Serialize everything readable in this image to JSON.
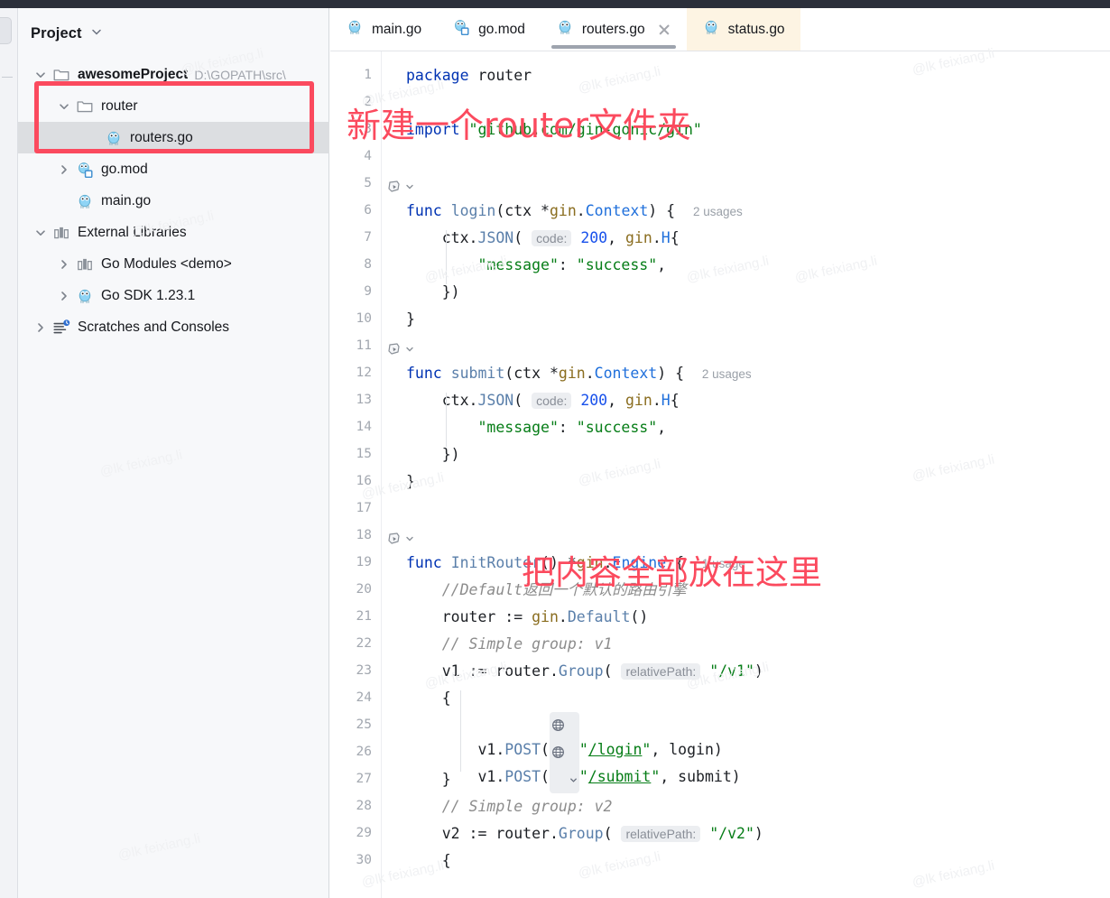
{
  "window": {
    "titlebar_color": "#2b2f3a"
  },
  "sidebar": {
    "title": "Project",
    "header_chevron_icon": "chevron-down-icon",
    "tree": [
      {
        "label": "awesomeProject",
        "sub": "D:\\GOPATH\\src\\",
        "icon": "folder-icon",
        "twisty": "chevron-down-icon",
        "depth": 0,
        "bold": true,
        "selected": false
      },
      {
        "label": "router",
        "sub": "",
        "icon": "folder-icon",
        "twisty": "chevron-down-icon",
        "depth": 1,
        "bold": false,
        "selected": false
      },
      {
        "label": "routers.go",
        "sub": "",
        "icon": "go-file-icon",
        "twisty": "",
        "depth": 2,
        "bold": false,
        "selected": true
      },
      {
        "label": "go.mod",
        "sub": "",
        "icon": "go-mod-icon",
        "twisty": "chevron-right-icon",
        "depth": 1,
        "bold": false,
        "selected": false
      },
      {
        "label": "main.go",
        "sub": "",
        "icon": "go-file-icon",
        "twisty": "",
        "depth": 1,
        "bold": false,
        "selected": false
      },
      {
        "label": "External Libraries",
        "sub": "",
        "icon": "library-icon",
        "twisty": "chevron-down-icon",
        "depth": 0,
        "bold": false,
        "selected": false
      },
      {
        "label": "Go Modules <demo>",
        "sub": "",
        "icon": "library-icon",
        "twisty": "chevron-right-icon",
        "depth": 1,
        "bold": false,
        "selected": false
      },
      {
        "label": "Go SDK 1.23.1",
        "sub": "",
        "icon": "go-file-icon",
        "twisty": "chevron-right-icon",
        "depth": 1,
        "bold": false,
        "selected": false
      },
      {
        "label": "Scratches and Consoles",
        "sub": "",
        "icon": "scratches-icon",
        "twisty": "chevron-right-icon",
        "depth": 0,
        "bold": false,
        "selected": false
      }
    ]
  },
  "tabs": [
    {
      "label": "main.go",
      "icon": "go-file-icon",
      "active": false,
      "cream": false,
      "closable": false
    },
    {
      "label": "go.mod",
      "icon": "go-mod-icon",
      "active": false,
      "cream": false,
      "closable": false
    },
    {
      "label": "routers.go",
      "icon": "go-file-icon",
      "active": true,
      "cream": false,
      "closable": true
    },
    {
      "label": "status.go",
      "icon": "go-file-icon",
      "active": false,
      "cream": true,
      "closable": false
    }
  ],
  "editor": {
    "first_line": 1,
    "last_line": 30,
    "lines": [
      {
        "n": 1,
        "text": "package router"
      },
      {
        "n": 2,
        "text": ""
      },
      {
        "n": 3,
        "text": "import \"github.com/gin-gonic/gin\""
      },
      {
        "n": 4,
        "text": ""
      },
      {
        "n": 5,
        "text": ""
      },
      {
        "n": 6,
        "text": "func login(ctx *gin.Context) {",
        "usages": "2 usages",
        "gutter": "run-gutter-icon"
      },
      {
        "n": 7,
        "text": "    ctx.JSON( code: 200, gin.H{"
      },
      {
        "n": 8,
        "text": "        \"message\": \"success\","
      },
      {
        "n": 9,
        "text": "    })"
      },
      {
        "n": 10,
        "text": "}"
      },
      {
        "n": 11,
        "text": ""
      },
      {
        "n": 12,
        "text": "func submit(ctx *gin.Context) {",
        "usages": "2 usages",
        "gutter": "run-gutter-icon"
      },
      {
        "n": 13,
        "text": "    ctx.JSON( code: 200, gin.H{"
      },
      {
        "n": 14,
        "text": "        \"message\": \"success\","
      },
      {
        "n": 15,
        "text": "    })"
      },
      {
        "n": 16,
        "text": "}"
      },
      {
        "n": 17,
        "text": ""
      },
      {
        "n": 18,
        "text": ""
      },
      {
        "n": 19,
        "text": "func InitRouter() *gin.Engine {",
        "usages": "1 usage",
        "gutter": "run-gutter-icon"
      },
      {
        "n": 20,
        "text": "    //Default返回一个默认的路由引擎"
      },
      {
        "n": 21,
        "text": "    router := gin.Default()"
      },
      {
        "n": 22,
        "text": "    // Simple group: v1"
      },
      {
        "n": 23,
        "text": "    v1 := router.Group( relativePath: \"/v1\")"
      },
      {
        "n": 24,
        "text": "    {"
      },
      {
        "n": 25,
        "text": "        v1.POST(\"/login\", login)"
      },
      {
        "n": 26,
        "text": "        v1.POST(\"/submit\", submit)"
      },
      {
        "n": 27,
        "text": "    }"
      },
      {
        "n": 28,
        "text": "    // Simple group: v2"
      },
      {
        "n": 29,
        "text": "    v2 := router.Group( relativePath: \"/v2\")"
      },
      {
        "n": 30,
        "text": "    {"
      }
    ],
    "param_hints": [
      "code:",
      "relativePath:"
    ],
    "usage_labels": [
      "2 usages",
      "2 usages",
      "1 usage"
    ],
    "gutter_icon": "run-gutter-icon",
    "url_icon": "globe-icon"
  },
  "annotations": [
    {
      "text": "新建一个router文件夹",
      "color": "#fb4a5e"
    },
    {
      "text": "把内容全部放在这里",
      "color": "#fb4a5e"
    }
  ],
  "highlight_box": {
    "color": "#fb4a5e"
  },
  "watermark": {
    "text": "@lk feixiang.li"
  },
  "colors": {
    "accent_red": "#fb4a5e",
    "keyword": "#0033b3",
    "string": "#067d17",
    "number": "#1750eb",
    "comment": "#8c8c8c",
    "type": "#1f6fdb",
    "cream_tab": "#fdf4e3",
    "selection": "#dcdee1"
  }
}
